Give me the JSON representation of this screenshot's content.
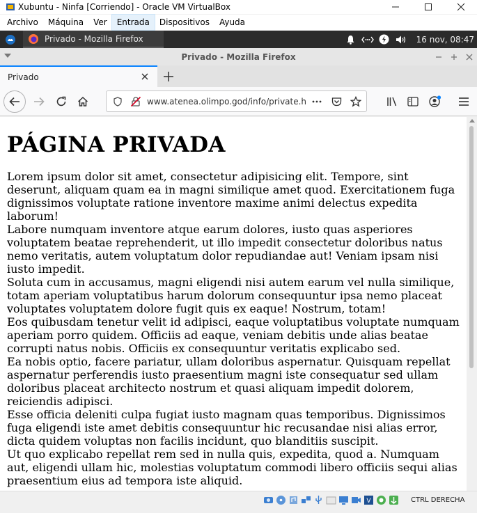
{
  "vbox": {
    "title": "Xubuntu - Ninfa [Corriendo] - Oracle VM VirtualBox",
    "menu": [
      {
        "label": "Archivo"
      },
      {
        "label": "Máquina"
      },
      {
        "label": "Ver"
      },
      {
        "label": "Entrada"
      },
      {
        "label": "Dispositivos"
      },
      {
        "label": "Ayuda"
      }
    ],
    "host_key": "CTRL DERECHA"
  },
  "panel": {
    "task_label": "Privado - Mozilla Firefox",
    "clock": "16 nov, 08:47"
  },
  "firefox": {
    "window_title": "Privado - Mozilla Firefox",
    "tab_label": "Privado",
    "url": "www.atenea.olimpo.god/info/private.h"
  },
  "page": {
    "title": "PÁGINA PRIVADA",
    "paragraphs": [
      "Lorem ipsum dolor sit amet, consectetur adipisicing elit. Tempore, sint deserunt, aliquam quam ea in magni similique amet quod. Exercitationem fuga dignissimos voluptate ratione inventore maxime animi delectus expedita laborum!",
      "Labore numquam inventore atque earum dolores, iusto quas asperiores voluptatem beatae reprehenderit, ut illo impedit consectetur doloribus natus nemo veritatis, autem voluptatum dolor repudiandae aut! Veniam ipsam nisi iusto impedit.",
      "Soluta cum in accusamus, magni eligendi nisi autem earum vel nulla similique, totam aperiam voluptatibus harum dolorum consequuntur ipsa nemo placeat voluptates voluptatem dolore fugit quis ex eaque! Nostrum, totam!",
      "Eos quibusdam tenetur velit id adipisci, eaque voluptatibus voluptate numquam aperiam porro quidem. Officiis ad eaque, veniam debitis unde alias beatae corrupti natus nobis. Officiis ex consequuntur veritatis explicabo sed.",
      "Ea nobis optio, facere pariatur, ullam doloribus aspernatur. Quisquam repellat aspernatur perferendis iusto praesentium magni iste consequatur sed ullam doloribus placeat architecto nostrum et quasi aliquam impedit dolorem, reiciendis adipisci.",
      "Esse officia deleniti culpa fugiat iusto magnam quas temporibus. Dignissimos fuga eligendi iste amet debitis consequuntur hic recusandae nisi alias error, dicta quidem voluptas non facilis incidunt, quo blanditiis suscipit.",
      "Ut quo explicabo repellat rem sed in nulla quis, expedita, quod a. Numquam aut, eligendi ullam hic, molestias voluptatum commodi libero officiis sequi alias praesentium eius ad tempora iste aliquid."
    ]
  },
  "colors": {
    "accent": "#0a84ff",
    "panel_bg": "#2b2b2b"
  }
}
